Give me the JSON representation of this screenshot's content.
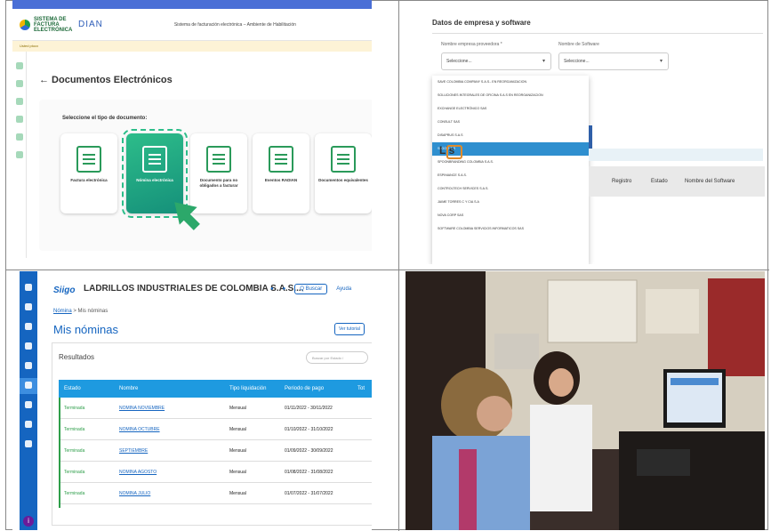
{
  "panel1": {
    "logo_text": "SISTEMA DE FACTURA ELECTRÓNICA",
    "dian": "DIAN",
    "system_title": "Sistema de facturación electrónica – Ambiente de Habilitación",
    "warning": "Usted ptocx",
    "page_title": "← Documentos Electrónicos",
    "select_label": "Seleccione el tipo de documento:",
    "cards": [
      {
        "label": "Factura electrónica",
        "icon": "invoice-icon"
      },
      {
        "label": "Nómina electrónica",
        "icon": "payroll-icon"
      },
      {
        "label": "Documento para no obligados a facturar",
        "icon": "document-check-icon"
      },
      {
        "label": "Eventos RADIAN",
        "icon": "events-icon"
      },
      {
        "label": "Documentos equivalentes",
        "icon": "documents-icon"
      }
    ]
  },
  "panel2": {
    "header": "Datos de empresa y software",
    "label_company": "Nombre empresa proveedora *",
    "label_software": "Nombre de Software",
    "select_placeholder": "Seleccione...",
    "software_placeholder": "Seleccione...",
    "options": [
      "SAVE COLOMBIA COMPANY S.A.S.- EN REORGANIZACION",
      "SOLUCIONES INTEGRALES DE OFICINA S.A.S EN REORGANIZACION",
      "EXCHANGE ELECTRÓNICO SAS",
      "CONSULT SAS",
      "DISAPRUS S.A.S",
      "SIIGO S.A.S",
      "SPOONBRANDING COLOMBIA S.A.S.",
      "ESPINIANCE S.A.S.",
      "CONTROLTECH SERVICES S.A.S.",
      "JAIME TORRES C Y CIA S.A",
      "NOVA CORP SAS",
      "SOFTWARE COLOMBIA SERVICIOS INFORMATICOS SAS"
    ],
    "list_title": "Lis",
    "table_headers": [
      "Registro",
      "Estado",
      "Nombre del Software"
    ]
  },
  "panel3": {
    "logo": "Siigo",
    "company": "LADRILLOS INDUSTRIALES DE COLOMBIA S.A.S....",
    "search_btn": "Q Buscar",
    "help": "Ayuda",
    "breadcrumb_link": "Nómina",
    "breadcrumb_rest": " > Mis nóminas",
    "title": "Mis nóminas",
    "tutorial": "Ver tutorial",
    "results": "Resultados",
    "search_placeholder": "Buscar por Estado /",
    "headers": [
      "Estado",
      "Nombre",
      "Tipo liquidación",
      "Periodo de pago",
      "Tot"
    ],
    "rows": [
      {
        "estado": "Terminada",
        "nombre": "NOMINA NOVIEMBRE",
        "tipo": "Mensual",
        "periodo": "01/11/2022 - 30/11/2022"
      },
      {
        "estado": "Terminada",
        "nombre": "NOMINA OCTUBRE",
        "tipo": "Mensual",
        "periodo": "01/10/2022 - 31/10/2022"
      },
      {
        "estado": "Terminada",
        "nombre": "SEPTIEMBRE",
        "tipo": "Mensual",
        "periodo": "01/09/2022 - 30/09/2022"
      },
      {
        "estado": "Terminada",
        "nombre": "NOMINA AGOSTO",
        "tipo": "Mensual",
        "periodo": "01/08/2022 - 31/08/2022"
      },
      {
        "estado": "Terminada",
        "nombre": "NOMINA JULIO",
        "tipo": "Mensual",
        "periodo": "01/07/2022 - 31/07/2022"
      }
    ]
  }
}
